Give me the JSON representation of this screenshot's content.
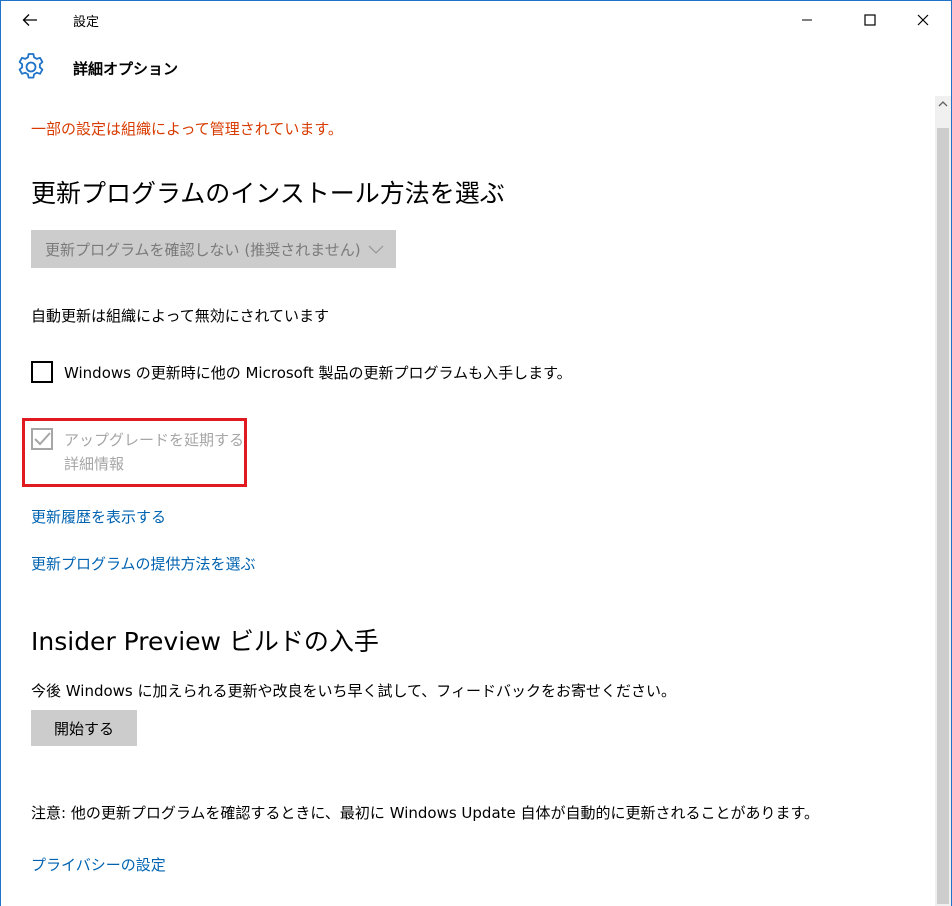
{
  "window": {
    "title": "設定"
  },
  "header": {
    "title": "詳細オプション"
  },
  "content": {
    "warning": "一部の設定は組織によって管理されています。",
    "install_heading": "更新プログラムのインストール方法を選ぶ",
    "install_dropdown_value": "更新プログラムを確認しない (推奨されません)",
    "auto_update_status": "自動更新は組織によって無効にされています",
    "other_products_checkbox_label": "Windows の更新時に他の Microsoft 製品の更新プログラムも入手します。",
    "defer_upgrade_label": "アップグレードを延期する",
    "defer_upgrade_details": "詳細情報",
    "history_link": "更新履歴を表示する",
    "delivery_link": "更新プログラムの提供方法を選ぶ",
    "insider_heading": "Insider Preview ビルドの入手",
    "insider_description": "今後 Windows に加えられる更新や改良をいち早く試して、フィードバックをお寄せください。",
    "insider_start_button": "開始する",
    "note": "注意: 他の更新プログラムを確認するときに、最初に Windows Update 自体が自動的に更新されることがあります。",
    "privacy_link": "プライバシーの設定"
  },
  "state": {
    "other_products_checked": false,
    "defer_upgrade_checked": true,
    "defer_upgrade_disabled": true,
    "dropdown_disabled": true
  },
  "colors": {
    "accent": "#1f73c8",
    "link": "#0063b1",
    "warning": "#d83b01",
    "highlight_box": "#e11a22",
    "disabled": "#a6a6a6",
    "control_bg": "#cccccc"
  },
  "icons": {
    "back": "arrow-left-icon",
    "settings": "gear-icon",
    "minimize": "minimize-icon",
    "maximize": "maximize-icon",
    "close": "close-icon",
    "dropdown": "chevron-down-icon",
    "checkmark": "checkmark-icon",
    "scroll_up": "scroll-up-arrow-icon"
  }
}
